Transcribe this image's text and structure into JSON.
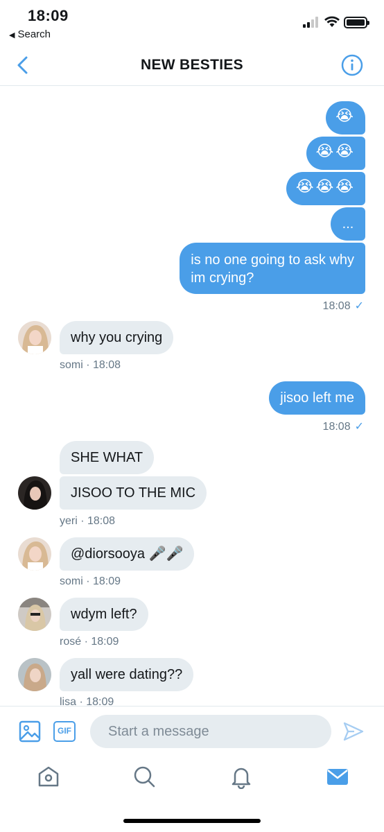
{
  "status_bar": {
    "time": "18:09",
    "back_app_label": "Search",
    "icons": [
      "cellular-signal-icon",
      "wifi-icon",
      "battery-icon"
    ]
  },
  "header": {
    "title": "NEW BESTIES",
    "back_icon": "chevron-left-icon",
    "info_icon": "info-icon"
  },
  "colors": {
    "accent": "#4a9ee8",
    "incoming_bubble": "#e6ecf0",
    "meta_text": "#657786"
  },
  "messages": [
    {
      "id": "m1",
      "direction": "out",
      "text": "😭"
    },
    {
      "id": "m2",
      "direction": "out",
      "text": "😭😭"
    },
    {
      "id": "m3",
      "direction": "out",
      "text": "😭😭😭"
    },
    {
      "id": "m4",
      "direction": "out",
      "text": "..."
    },
    {
      "id": "m5",
      "direction": "out",
      "text_lines": [
        "is no one going to ask why",
        "im crying?"
      ],
      "meta": "18:08",
      "status": "✓"
    },
    {
      "id": "m6",
      "direction": "in",
      "text": "why you crying",
      "meta": "somi · 18:08"
    },
    {
      "id": "m7",
      "direction": "out",
      "text": "jisoo left me",
      "meta": "18:08",
      "status": "✓"
    },
    {
      "id": "m8",
      "direction": "in",
      "text": "SHE WHAT"
    },
    {
      "id": "m9",
      "direction": "in",
      "text": "JISOO TO THE MIC",
      "meta": "yeri · 18:08"
    },
    {
      "id": "m10",
      "direction": "in",
      "text": "@diorsooya 🎤🎤",
      "meta": "somi · 18:09"
    },
    {
      "id": "m11",
      "direction": "in",
      "text": "wdym left?",
      "meta": "rosé · 18:09"
    },
    {
      "id": "m12",
      "direction": "in",
      "text": "yall were dating??",
      "meta": "lisa  · 18:09"
    }
  ],
  "composer": {
    "placeholder": "Start a message",
    "image_icon": "image-icon",
    "gif_label": "GIF",
    "send_icon": "send-icon"
  },
  "tabbar": {
    "items": [
      "home-icon",
      "search-icon",
      "notifications-bell-icon",
      "messages-mail-icon"
    ],
    "active": "messages-mail-icon"
  }
}
